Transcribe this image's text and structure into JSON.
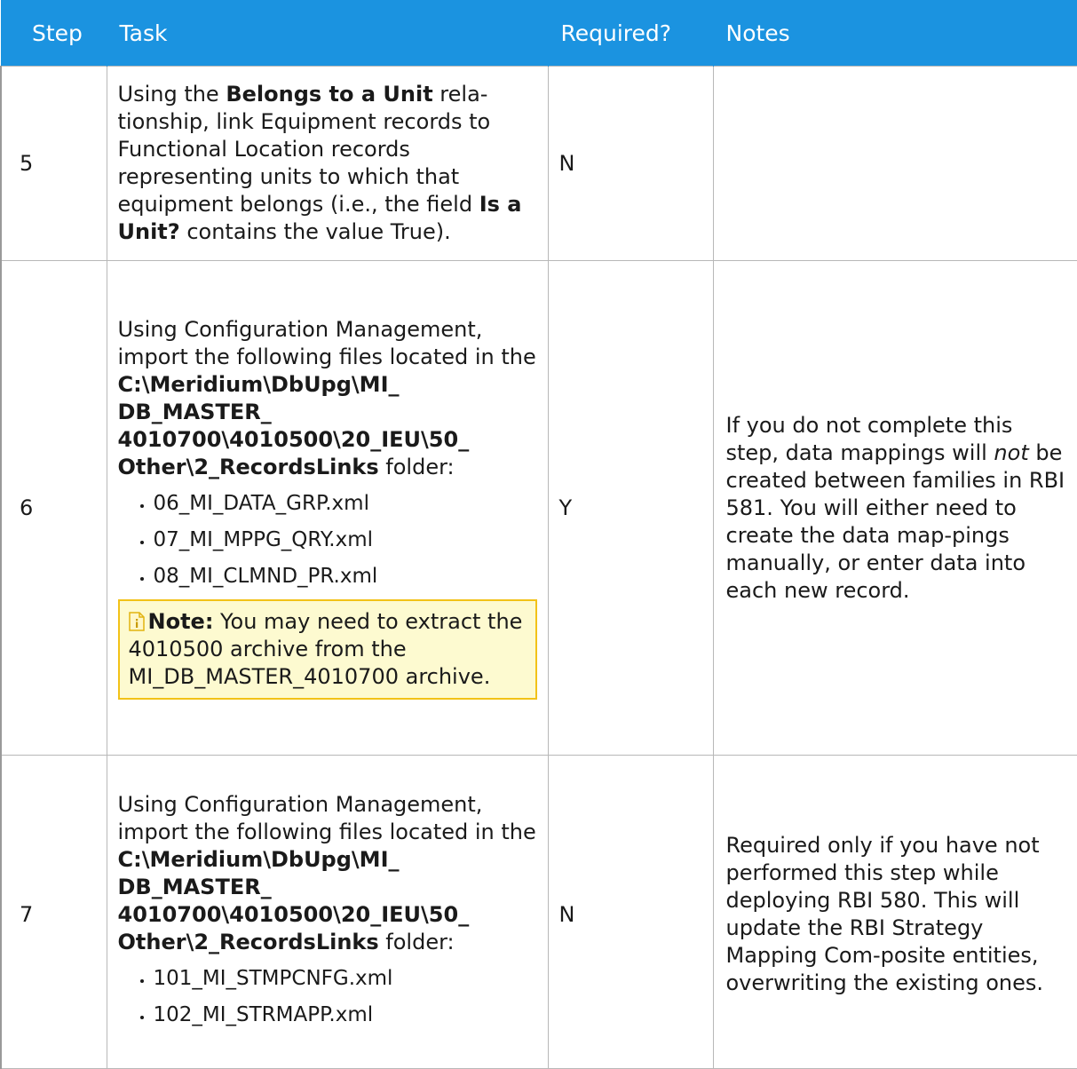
{
  "headers": {
    "step": "Step",
    "task": "Task",
    "required": "Required?",
    "notes": "Notes"
  },
  "rows": [
    {
      "step": "5",
      "task": {
        "t1": "Using the ",
        "b1": "Belongs to a Unit",
        "t2": " rela-tionship, link Equipment records to Functional Location records representing units to which that equipment belongs (i.e., the field ",
        "b2": "Is a Unit?",
        "t3": " contains the value True)."
      },
      "required": "N",
      "notes": ""
    },
    {
      "step": "6",
      "task": {
        "t1": "Using Configuration Management, import the following files located in the ",
        "path": "C:\\Meridium\\DbUpg\\MI_ DB_MASTER_ 4010700\\4010500\\20_IEU\\50_ Other\\2_RecordsLinks",
        "t2": " folder:",
        "files": [
          "06_MI_DATA_GRP.xml",
          "07_MI_MPPG_QRY.xml",
          "08_MI_CLMND_PR.xml"
        ],
        "note_label": "Note:",
        "note_text": " You may need to extract the 4010500 archive from the MI_DB_MASTER_4010700 archive."
      },
      "required": "Y",
      "notes": {
        "t1": "If you do not complete this step, data mappings will ",
        "i1": "not",
        "t2": " be created between families in RBI 581. You will either need to create the data map-pings manually, or enter data into each new record."
      }
    },
    {
      "step": "7",
      "task": {
        "t1": "Using Configuration Management, import the following files located in the ",
        "path": "C:\\Meridium\\DbUpg\\MI_ DB_MASTER_ 4010700\\4010500\\20_IEU\\50_ Other\\2_RecordsLinks",
        "t2": " folder:",
        "files": [
          "101_MI_STMPCNFG.xml",
          "102_MI_STRMAPP.xml"
        ]
      },
      "required": "N",
      "notes": "Required only if you have not performed this step while deploying RBI 580. This will update the RBI Strategy Mapping Com-posite entities, overwriting the existing ones."
    }
  ],
  "colors": {
    "header_bg": "#1b93e0",
    "header_text": "#ffffff",
    "note_bg": "#fdfad0",
    "note_border": "#f2c218"
  },
  "icons": {
    "note": "note-info-icon"
  }
}
